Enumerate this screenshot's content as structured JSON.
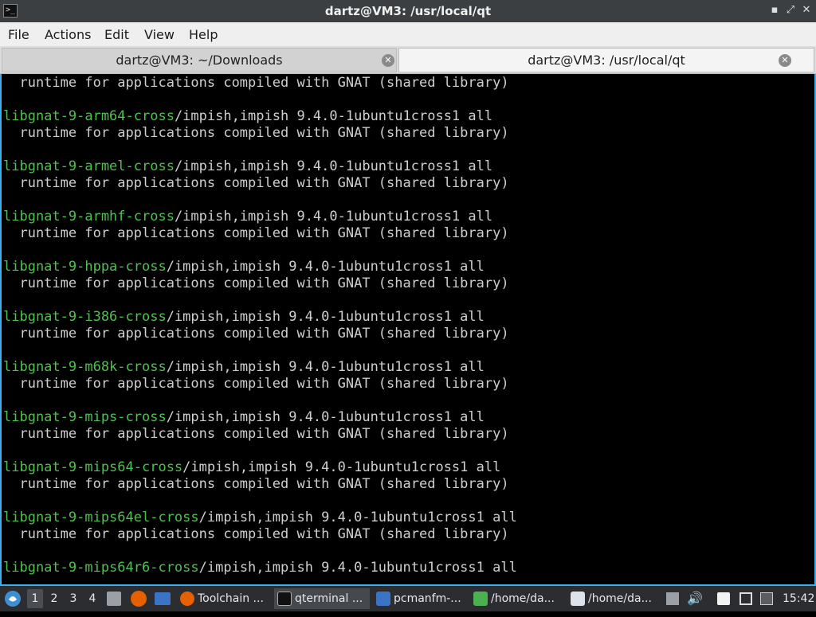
{
  "window": {
    "title": "dartz@VM3: /usr/local/qt",
    "terminal_icon": ">_"
  },
  "menu": [
    "File",
    "Actions",
    "Edit",
    "View",
    "Help"
  ],
  "tabs": [
    {
      "label": "dartz@VM3: ~/Downloads",
      "active": false
    },
    {
      "label": "dartz@VM3: /usr/local/qt",
      "active": true
    }
  ],
  "terminal": {
    "colors": {
      "package": "#4ec14e",
      "text": "#cfcfcf",
      "background": "#000000"
    },
    "lines": [
      {
        "pkg": "",
        "rest": "  runtime for applications compiled with GNAT (shared library)"
      },
      {
        "pkg": "",
        "rest": ""
      },
      {
        "pkg": "libgnat-9-arm64-cross",
        "rest": "/impish,impish 9.4.0-1ubuntu1cross1 all"
      },
      {
        "pkg": "",
        "rest": "  runtime for applications compiled with GNAT (shared library)"
      },
      {
        "pkg": "",
        "rest": ""
      },
      {
        "pkg": "libgnat-9-armel-cross",
        "rest": "/impish,impish 9.4.0-1ubuntu1cross1 all"
      },
      {
        "pkg": "",
        "rest": "  runtime for applications compiled with GNAT (shared library)"
      },
      {
        "pkg": "",
        "rest": ""
      },
      {
        "pkg": "libgnat-9-armhf-cross",
        "rest": "/impish,impish 9.4.0-1ubuntu1cross1 all"
      },
      {
        "pkg": "",
        "rest": "  runtime for applications compiled with GNAT (shared library)"
      },
      {
        "pkg": "",
        "rest": ""
      },
      {
        "pkg": "libgnat-9-hppa-cross",
        "rest": "/impish,impish 9.4.0-1ubuntu1cross1 all"
      },
      {
        "pkg": "",
        "rest": "  runtime for applications compiled with GNAT (shared library)"
      },
      {
        "pkg": "",
        "rest": ""
      },
      {
        "pkg": "libgnat-9-i386-cross",
        "rest": "/impish,impish 9.4.0-1ubuntu1cross1 all"
      },
      {
        "pkg": "",
        "rest": "  runtime for applications compiled with GNAT (shared library)"
      },
      {
        "pkg": "",
        "rest": ""
      },
      {
        "pkg": "libgnat-9-m68k-cross",
        "rest": "/impish,impish 9.4.0-1ubuntu1cross1 all"
      },
      {
        "pkg": "",
        "rest": "  runtime for applications compiled with GNAT (shared library)"
      },
      {
        "pkg": "",
        "rest": ""
      },
      {
        "pkg": "libgnat-9-mips-cross",
        "rest": "/impish,impish 9.4.0-1ubuntu1cross1 all"
      },
      {
        "pkg": "",
        "rest": "  runtime for applications compiled with GNAT (shared library)"
      },
      {
        "pkg": "",
        "rest": ""
      },
      {
        "pkg": "libgnat-9-mips64-cross",
        "rest": "/impish,impish 9.4.0-1ubuntu1cross1 all"
      },
      {
        "pkg": "",
        "rest": "  runtime for applications compiled with GNAT (shared library)"
      },
      {
        "pkg": "",
        "rest": ""
      },
      {
        "pkg": "libgnat-9-mips64el-cross",
        "rest": "/impish,impish 9.4.0-1ubuntu1cross1 all"
      },
      {
        "pkg": "",
        "rest": "  runtime for applications compiled with GNAT (shared library)"
      },
      {
        "pkg": "",
        "rest": ""
      },
      {
        "pkg": "libgnat-9-mips64r6-cross",
        "rest": "/impish,impish 9.4.0-1ubuntu1cross1 all"
      }
    ]
  },
  "taskbar": {
    "workspaces": [
      "1",
      "2",
      "3",
      "4"
    ],
    "active_workspace": "1",
    "tasks": [
      {
        "label": "Toolchain ...",
        "icon": "firefox-icon"
      },
      {
        "label": "qterminal ...",
        "icon": "terminal-icon"
      },
      {
        "label": "pcmanfm-...",
        "icon": "folder-icon"
      },
      {
        "label": "/home/da...",
        "icon": "text-editor-icon"
      },
      {
        "label": "/home/da...",
        "icon": "featherpad-icon"
      }
    ],
    "clock": "15:42"
  }
}
